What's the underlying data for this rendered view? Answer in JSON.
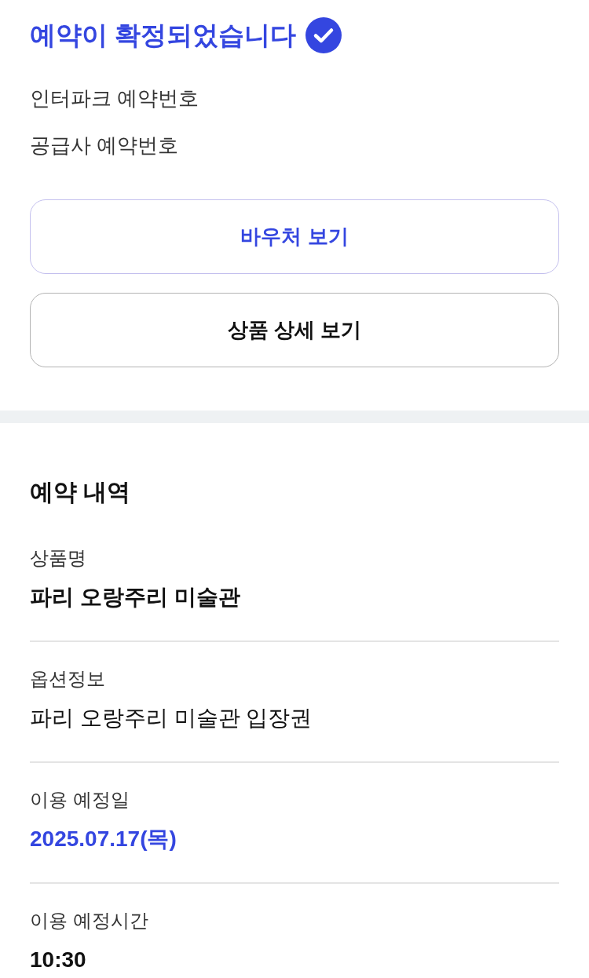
{
  "header": {
    "title": "예약이 확정되었습니다",
    "confirmed": true
  },
  "reference_numbers": [
    {
      "label": "인터파크 예약번호"
    },
    {
      "label": "공급사 예약번호"
    }
  ],
  "buttons": [
    {
      "label": "바우처 보기",
      "kind": "primary"
    },
    {
      "label": "상품 상세 보기",
      "kind": "secondary"
    }
  ],
  "details": {
    "title": "예약 내역",
    "items": [
      {
        "label": "상품명",
        "value": "파리 오랑주리 미술관",
        "kind": "bold"
      },
      {
        "label": "옵션정보",
        "value": "파리 오랑주리 미술관 입장권",
        "kind": "plain"
      },
      {
        "label": "이용 예정일",
        "value": "2025.07.17(목)",
        "kind": "highlight"
      },
      {
        "label": "이용 예정시간",
        "value": "10:30",
        "kind": "bold"
      }
    ]
  }
}
